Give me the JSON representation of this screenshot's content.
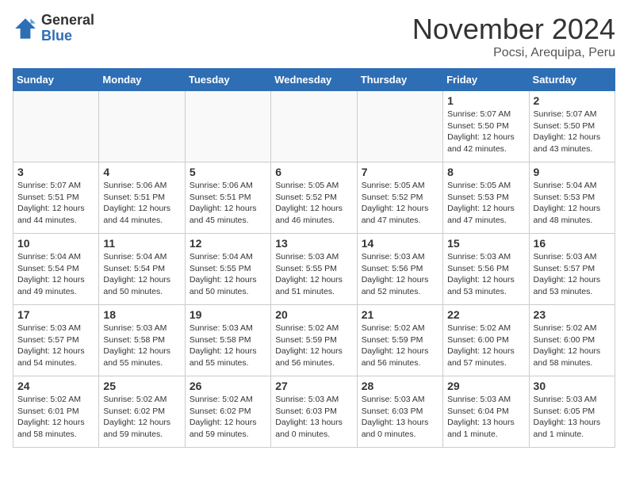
{
  "header": {
    "logo_general": "General",
    "logo_blue": "Blue",
    "month_title": "November 2024",
    "location": "Pocsi, Arequipa, Peru"
  },
  "days_of_week": [
    "Sunday",
    "Monday",
    "Tuesday",
    "Wednesday",
    "Thursday",
    "Friday",
    "Saturday"
  ],
  "weeks": [
    [
      {
        "day": "",
        "info": ""
      },
      {
        "day": "",
        "info": ""
      },
      {
        "day": "",
        "info": ""
      },
      {
        "day": "",
        "info": ""
      },
      {
        "day": "",
        "info": ""
      },
      {
        "day": "1",
        "info": "Sunrise: 5:07 AM\nSunset: 5:50 PM\nDaylight: 12 hours\nand 42 minutes."
      },
      {
        "day": "2",
        "info": "Sunrise: 5:07 AM\nSunset: 5:50 PM\nDaylight: 12 hours\nand 43 minutes."
      }
    ],
    [
      {
        "day": "3",
        "info": "Sunrise: 5:07 AM\nSunset: 5:51 PM\nDaylight: 12 hours\nand 44 minutes."
      },
      {
        "day": "4",
        "info": "Sunrise: 5:06 AM\nSunset: 5:51 PM\nDaylight: 12 hours\nand 44 minutes."
      },
      {
        "day": "5",
        "info": "Sunrise: 5:06 AM\nSunset: 5:51 PM\nDaylight: 12 hours\nand 45 minutes."
      },
      {
        "day": "6",
        "info": "Sunrise: 5:05 AM\nSunset: 5:52 PM\nDaylight: 12 hours\nand 46 minutes."
      },
      {
        "day": "7",
        "info": "Sunrise: 5:05 AM\nSunset: 5:52 PM\nDaylight: 12 hours\nand 47 minutes."
      },
      {
        "day": "8",
        "info": "Sunrise: 5:05 AM\nSunset: 5:53 PM\nDaylight: 12 hours\nand 47 minutes."
      },
      {
        "day": "9",
        "info": "Sunrise: 5:04 AM\nSunset: 5:53 PM\nDaylight: 12 hours\nand 48 minutes."
      }
    ],
    [
      {
        "day": "10",
        "info": "Sunrise: 5:04 AM\nSunset: 5:54 PM\nDaylight: 12 hours\nand 49 minutes."
      },
      {
        "day": "11",
        "info": "Sunrise: 5:04 AM\nSunset: 5:54 PM\nDaylight: 12 hours\nand 50 minutes."
      },
      {
        "day": "12",
        "info": "Sunrise: 5:04 AM\nSunset: 5:55 PM\nDaylight: 12 hours\nand 50 minutes."
      },
      {
        "day": "13",
        "info": "Sunrise: 5:03 AM\nSunset: 5:55 PM\nDaylight: 12 hours\nand 51 minutes."
      },
      {
        "day": "14",
        "info": "Sunrise: 5:03 AM\nSunset: 5:56 PM\nDaylight: 12 hours\nand 52 minutes."
      },
      {
        "day": "15",
        "info": "Sunrise: 5:03 AM\nSunset: 5:56 PM\nDaylight: 12 hours\nand 53 minutes."
      },
      {
        "day": "16",
        "info": "Sunrise: 5:03 AM\nSunset: 5:57 PM\nDaylight: 12 hours\nand 53 minutes."
      }
    ],
    [
      {
        "day": "17",
        "info": "Sunrise: 5:03 AM\nSunset: 5:57 PM\nDaylight: 12 hours\nand 54 minutes."
      },
      {
        "day": "18",
        "info": "Sunrise: 5:03 AM\nSunset: 5:58 PM\nDaylight: 12 hours\nand 55 minutes."
      },
      {
        "day": "19",
        "info": "Sunrise: 5:03 AM\nSunset: 5:58 PM\nDaylight: 12 hours\nand 55 minutes."
      },
      {
        "day": "20",
        "info": "Sunrise: 5:02 AM\nSunset: 5:59 PM\nDaylight: 12 hours\nand 56 minutes."
      },
      {
        "day": "21",
        "info": "Sunrise: 5:02 AM\nSunset: 5:59 PM\nDaylight: 12 hours\nand 56 minutes."
      },
      {
        "day": "22",
        "info": "Sunrise: 5:02 AM\nSunset: 6:00 PM\nDaylight: 12 hours\nand 57 minutes."
      },
      {
        "day": "23",
        "info": "Sunrise: 5:02 AM\nSunset: 6:00 PM\nDaylight: 12 hours\nand 58 minutes."
      }
    ],
    [
      {
        "day": "24",
        "info": "Sunrise: 5:02 AM\nSunset: 6:01 PM\nDaylight: 12 hours\nand 58 minutes."
      },
      {
        "day": "25",
        "info": "Sunrise: 5:02 AM\nSunset: 6:02 PM\nDaylight: 12 hours\nand 59 minutes."
      },
      {
        "day": "26",
        "info": "Sunrise: 5:02 AM\nSunset: 6:02 PM\nDaylight: 12 hours\nand 59 minutes."
      },
      {
        "day": "27",
        "info": "Sunrise: 5:03 AM\nSunset: 6:03 PM\nDaylight: 13 hours\nand 0 minutes."
      },
      {
        "day": "28",
        "info": "Sunrise: 5:03 AM\nSunset: 6:03 PM\nDaylight: 13 hours\nand 0 minutes."
      },
      {
        "day": "29",
        "info": "Sunrise: 5:03 AM\nSunset: 6:04 PM\nDaylight: 13 hours\nand 1 minute."
      },
      {
        "day": "30",
        "info": "Sunrise: 5:03 AM\nSunset: 6:05 PM\nDaylight: 13 hours\nand 1 minute."
      }
    ]
  ]
}
